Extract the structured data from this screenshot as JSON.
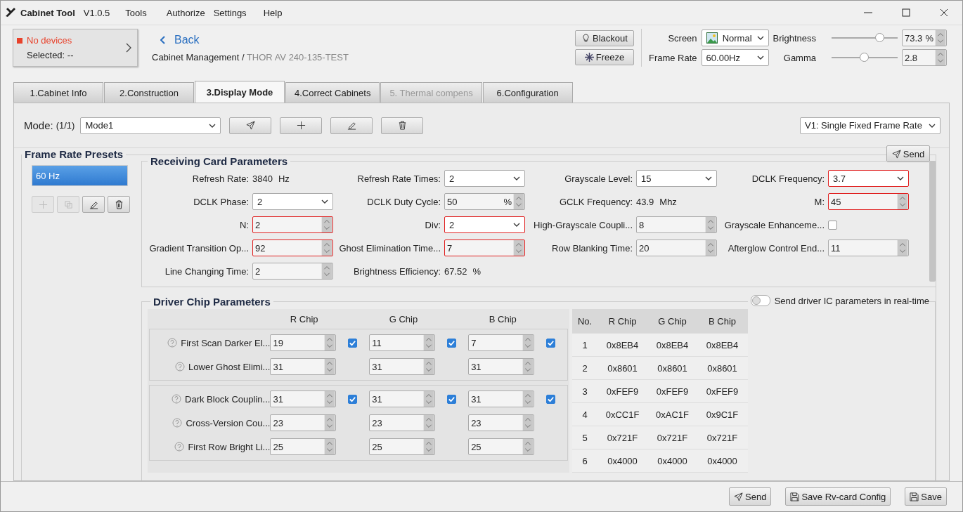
{
  "window": {
    "title": "Cabinet Tool",
    "version": "V1.0.5",
    "menu": [
      "Tools",
      "Authorize",
      "Settings",
      "Help"
    ]
  },
  "device": {
    "status": "No devices",
    "selected": "Selected: --"
  },
  "nav": {
    "back": "Back",
    "breadcrumb": "Cabinet Management /",
    "current": "THOR AV 240-135-TEST"
  },
  "controls": {
    "blackout": "Blackout",
    "freeze": "Freeze",
    "screen_label": "Screen",
    "screen_value": "Normal",
    "frame_rate_label": "Frame Rate",
    "frame_rate_value": "60.00Hz",
    "brightness": {
      "label": "Brightness",
      "level": 0.73,
      "value": "73.3",
      "unit": "%"
    },
    "gamma": {
      "label": "Gamma",
      "level": 0.5,
      "value": "2.8"
    }
  },
  "tabs": [
    {
      "label": "1.Cabinet Info",
      "selected": false,
      "disabled": false
    },
    {
      "label": "2.Construction",
      "selected": false,
      "disabled": false
    },
    {
      "label": "3.Display Mode",
      "selected": true,
      "disabled": false
    },
    {
      "label": "4.Correct Cabinets",
      "selected": false,
      "disabled": false
    },
    {
      "label": "5. Thermal compens",
      "selected": false,
      "disabled": true
    },
    {
      "label": "6.Configuration",
      "selected": false,
      "disabled": false
    }
  ],
  "mode": {
    "label": "Mode:",
    "count": "(1/1)",
    "value": "Mode1",
    "version": "V1: Single Fixed Frame Rate"
  },
  "presets": {
    "title": "Frame Rate Presets",
    "send": "Send",
    "items": [
      {
        "label": "60 Hz",
        "selected": true
      }
    ],
    "tools": [
      {
        "kind": "add",
        "disabled": true
      },
      {
        "kind": "copy",
        "disabled": true
      },
      {
        "kind": "edit",
        "disabled": false
      },
      {
        "kind": "delete",
        "disabled": false
      }
    ]
  },
  "receiving_card": {
    "title": "Receiving Card Parameters",
    "items": [
      {
        "label": "Refresh Rate:",
        "kind": "text",
        "value": "3840",
        "unit": "Hz"
      },
      {
        "label": "Refresh Rate Times:",
        "kind": "select",
        "value": "2",
        "error": false
      },
      {
        "label": "Grayscale Level:",
        "kind": "select",
        "value": "15",
        "error": false
      },
      {
        "label": "DCLK Frequency:",
        "kind": "select",
        "value": "3.7",
        "error": true
      },
      {
        "label": "DCLK Phase:",
        "kind": "select",
        "value": "2",
        "error": false
      },
      {
        "label": "DCLK Duty Cycle:",
        "kind": "spin",
        "value": "50",
        "unit": "%",
        "error": false
      },
      {
        "label": "GCLK Frequency:",
        "kind": "text",
        "value": "43.9",
        "unit": "Mhz"
      },
      {
        "label": "M:",
        "kind": "spin",
        "value": "45",
        "error": true
      },
      {
        "label": "N:",
        "kind": "spin",
        "value": "2",
        "error": true
      },
      {
        "label": "Div:",
        "kind": "select",
        "value": "2",
        "error": true
      },
      {
        "label": "High-Grayscale Coupli...",
        "kind": "spin",
        "value": "8",
        "error": false
      },
      {
        "label": "Grayscale Enhanceme...",
        "kind": "checkbox",
        "checked": false
      },
      {
        "label": "Gradient Transition Op...",
        "kind": "spin",
        "value": "92",
        "error": true
      },
      {
        "label": "Ghost Elimination Time...",
        "kind": "spin",
        "value": "7",
        "error": true
      },
      {
        "label": "Row Blanking Time:",
        "kind": "spin",
        "value": "20",
        "error": false
      },
      {
        "label": "Afterglow Control End...",
        "kind": "spin",
        "value": "11",
        "error": false
      },
      {
        "label": "Line Changing Time:",
        "kind": "spin",
        "value": "2",
        "error": false
      },
      {
        "label": "Brightness Efficiency:",
        "kind": "text",
        "value": "67.52",
        "unit": "%"
      }
    ]
  },
  "driver_chip": {
    "title": "Driver Chip Parameters",
    "realtime_label": "Send driver IC parameters in real-time",
    "realtime_on": false,
    "columns": [
      "R Chip",
      "G Chip",
      "B Chip"
    ],
    "groups": [
      [
        {
          "label": "First Scan Darker El...",
          "cells": [
            {
              "value": "19",
              "checked": true
            },
            {
              "value": "11",
              "checked": true
            },
            {
              "value": "7",
              "checked": true
            }
          ]
        },
        {
          "label": "Lower Ghost Elimi...",
          "cells": [
            {
              "value": "31"
            },
            {
              "value": "31"
            },
            {
              "value": "31"
            }
          ]
        }
      ],
      [
        {
          "label": "Dark Block Couplin...",
          "cells": [
            {
              "value": "31",
              "checked": true
            },
            {
              "value": "31",
              "checked": true
            },
            {
              "value": "31",
              "checked": true
            }
          ]
        },
        {
          "label": "Cross-Version Cou...",
          "cells": [
            {
              "value": "23"
            },
            {
              "value": "23"
            },
            {
              "value": "23"
            }
          ]
        },
        {
          "label": "First Row Bright Li...",
          "cells": [
            {
              "value": "25"
            },
            {
              "value": "25"
            },
            {
              "value": "25"
            }
          ]
        }
      ]
    ],
    "table": {
      "columns": [
        "No.",
        "R Chip",
        "G Chip",
        "B Chip"
      ],
      "rows": [
        [
          "1",
          "0x8EB4",
          "0x8EB4",
          "0x8EB4"
        ],
        [
          "2",
          "0x8601",
          "0x8601",
          "0x8601"
        ],
        [
          "3",
          "0xFEF9",
          "0xFEF9",
          "0xFEF9"
        ],
        [
          "4",
          "0xCC1F",
          "0xAC1F",
          "0x9C1F"
        ],
        [
          "5",
          "0x721F",
          "0x721F",
          "0x721F"
        ],
        [
          "6",
          "0x4000",
          "0x4000",
          "0x4000"
        ]
      ]
    }
  },
  "footer": {
    "send": "Send",
    "save_rv": "Save Rv-card Config",
    "save": "Save"
  }
}
